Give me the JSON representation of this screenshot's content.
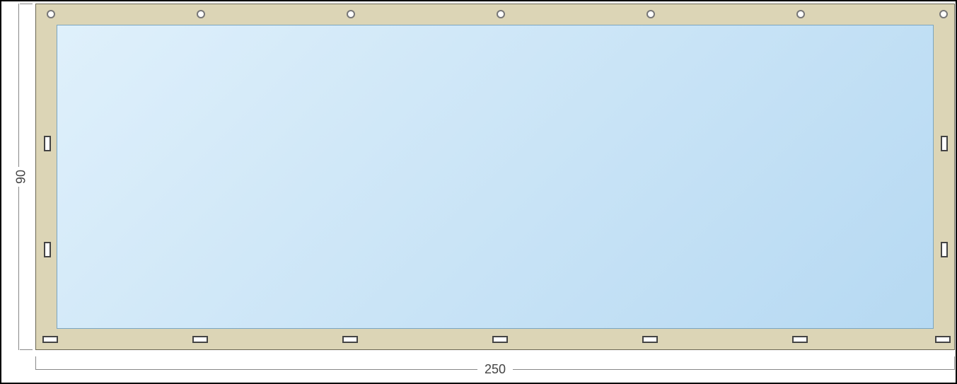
{
  "dimensions": {
    "width_label": "250",
    "height_label": "90"
  },
  "frame": {
    "border_color": "#dcd5b6",
    "window_gradient_start": "#dff0fb",
    "window_gradient_end": "#b6d9f2"
  },
  "top_grommets_count": 7,
  "bottom_tabs_count": 7,
  "side_tabs_each": 2
}
